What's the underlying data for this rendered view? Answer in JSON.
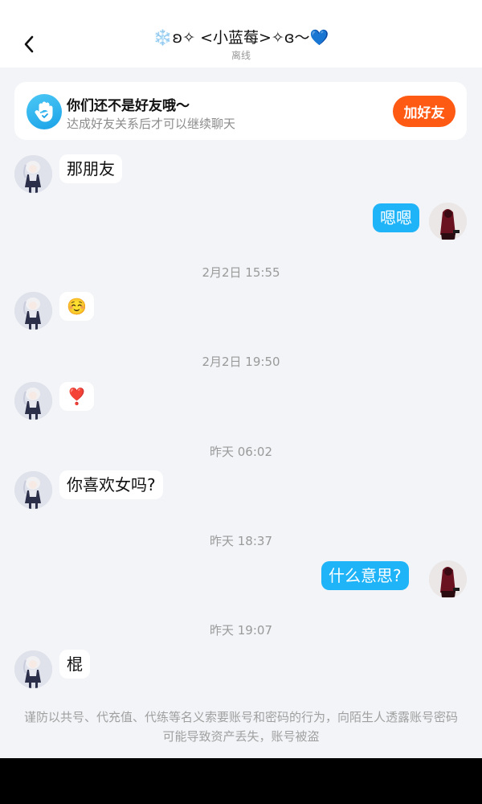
{
  "header": {
    "title": "❄️ʚ✧ <小蓝莓>✧ɞ〜💙",
    "status": "离线"
  },
  "banner": {
    "title": "你们还不是好友哦～",
    "subtitle": "达成好友关系后才可以继续聊天",
    "button": "加好友"
  },
  "messages": {
    "m1": "那朋友",
    "m2": "嗯嗯",
    "t1": "2月2日 15:55",
    "m3": "☺️",
    "t2": "2月2日 19:50",
    "m4": "❣️",
    "t3": "昨天 06:02",
    "m5": "你喜欢女吗?",
    "t4": "昨天 18:37",
    "m6": "什么意思?",
    "t5": "昨天 19:07",
    "m7": "棍"
  },
  "footer": {
    "notice": "谨防以共号、代充值、代练等名义索要账号和密码的行为，向陌生人透露账号密码可能导致资产丢失，账号被盗"
  },
  "colors": {
    "accent_blue": "#1fb3f7",
    "add_friend_orange": "#ff5a14",
    "background": "#f2f4f7"
  }
}
